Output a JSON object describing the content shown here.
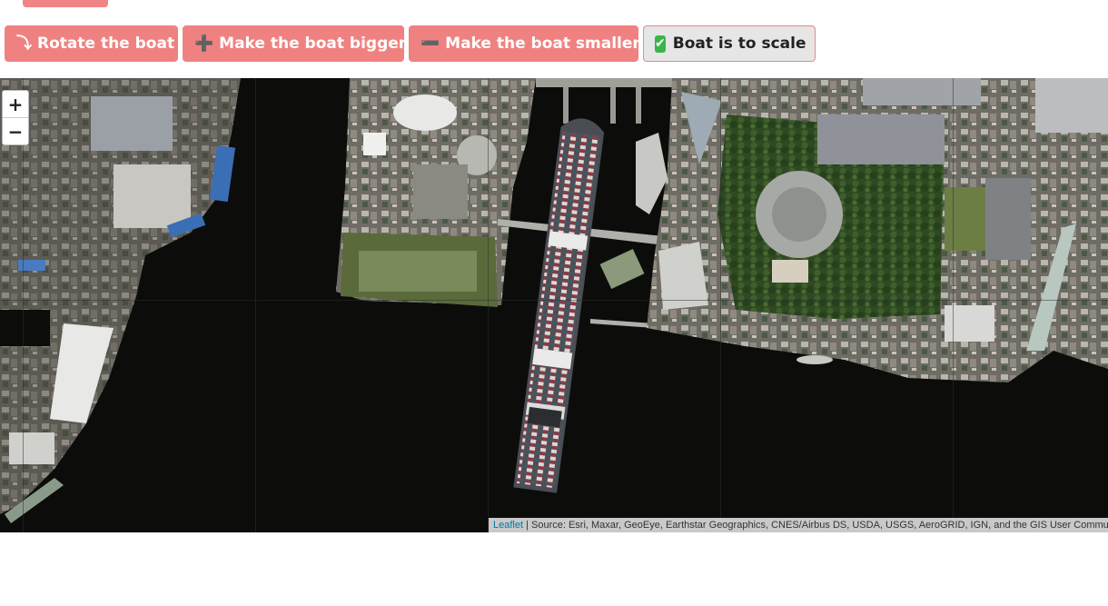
{
  "toolbar": {
    "rotate": {
      "icon": "rotate-arrow-icon",
      "glyph": "⤵",
      "label": "Rotate the boat"
    },
    "bigger": {
      "icon": "plus-icon",
      "glyph": "➕",
      "label": "Make the boat bigger"
    },
    "smaller": {
      "icon": "minus-icon",
      "glyph": "➖",
      "label": "Make the boat smaller"
    },
    "scale": {
      "icon": "check-mark-icon",
      "glyph": "✔",
      "label": "Boat is to scale"
    }
  },
  "map": {
    "zoom_in": "+",
    "zoom_out": "−",
    "attribution_link": "Leaflet",
    "attribution_text": " | Source: Esri, Maxar, GeoEye, Earthstar Geographics, CNES/Airbus DS, USDA, USGS, AeroGRID, IGN, and the GIS User Community"
  },
  "colors": {
    "button_pink": "#ef8281",
    "button_scale_bg": "#e6e6e6",
    "water": "#0c0d0b",
    "link": "#0078a8"
  }
}
